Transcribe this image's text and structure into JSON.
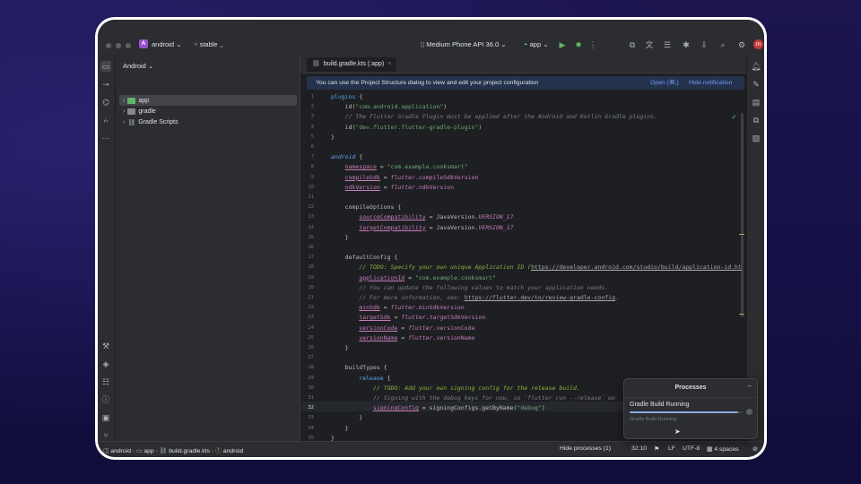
{
  "window": {
    "project_badge": "A",
    "project_name": "android",
    "branch": "stable",
    "device": "Medium Phone API 36.0",
    "run_config": "app",
    "avatar_letter": "m"
  },
  "project_panel": {
    "view_mode": "Android",
    "items": [
      {
        "label": "app"
      },
      {
        "label": "gradle"
      },
      {
        "label": "Gradle Scripts"
      }
    ]
  },
  "editor": {
    "tab_label": "build.gradle.kts (:app)",
    "banner_text": "You can use the Project Structure dialog to view and edit your project configuration",
    "banner_open": "Open (⌘;)",
    "banner_hide": "Hide notification",
    "line_numbers": [
      "1",
      "2",
      "3",
      "4",
      "5",
      "6",
      "7",
      "8",
      "9",
      "10",
      "11",
      "12",
      "13",
      "14",
      "15",
      "16",
      "17",
      "18",
      "19",
      "20",
      "21",
      "22",
      "23",
      "24",
      "25",
      "26",
      "27",
      "28",
      "29",
      "30",
      "31",
      "32",
      "33",
      "34",
      "35"
    ],
    "current_line": 32
  },
  "status_bar": {
    "breadcrumbs": [
      "android",
      "app",
      "build.gradle.kts",
      "android"
    ],
    "hide_processes": "Hide processes (1)",
    "position": "32:10",
    "line_sep": "LF",
    "encoding": "UTF-8",
    "indent": "4 spaces"
  },
  "processes_popup": {
    "title": "Processes",
    "task": "Gradle Build Running",
    "subtext": "Gradle Build Running",
    "progress": 0.96
  },
  "colors": {
    "accent": "#6e9ff7",
    "editor_bg": "#1e1f22",
    "panel_bg": "#2b2d30"
  }
}
